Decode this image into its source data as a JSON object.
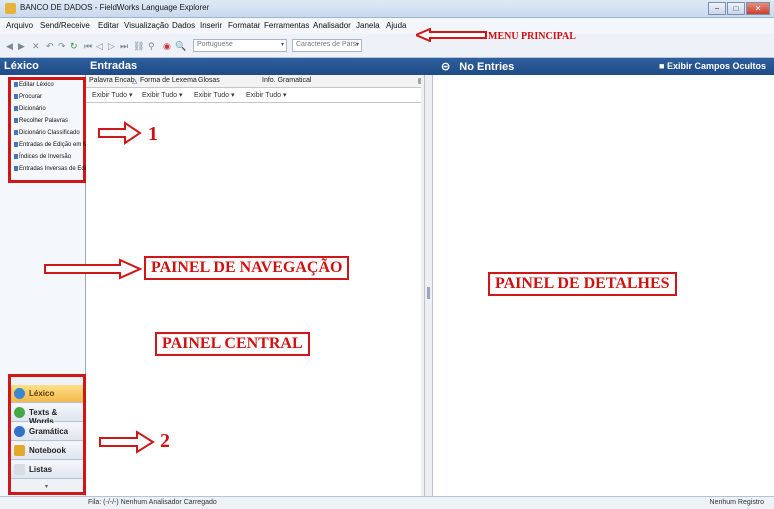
{
  "window": {
    "title": "BANCO DE DADOS - FieldWorks Language Explorer",
    "controls": [
      "−",
      "□",
      "✕"
    ]
  },
  "menu": {
    "items": [
      "Arquivo",
      "Send/Receive",
      "Editar",
      "Visualização",
      "Dados",
      "Inserir",
      "Formatar",
      "Ferramentas",
      "Analisador",
      "Janela",
      "Ajuda"
    ]
  },
  "toolbar": {
    "language": "Portuguese",
    "characters": "Caracteres de Parsi"
  },
  "nav": {
    "header": "Léxico",
    "items": [
      "Editar Léxico",
      "Procurar",
      "Dicionário",
      "Recolher Palavras",
      "Dicionário Classificado",
      "Entradas de Edição em M",
      "Índices de Inversão",
      "Entradas Inversas de Edi"
    ],
    "areas": [
      "Léxico",
      "Texts & Words",
      "Gramática",
      "Notebook",
      "Listas"
    ]
  },
  "center": {
    "header": "Entradas",
    "columns": [
      "Palavra Encab.",
      "Forma de Lexema",
      "Glosas",
      "Info. Gramatical"
    ],
    "filter_label": "Exibir Tudo"
  },
  "detail": {
    "header": "No Entries",
    "show_hidden": "Exibir Campos Ocultos"
  },
  "status": {
    "left": "Fila: (-/-/-) Nenhum Analisador Carregado",
    "right": "Nenhum Registro"
  },
  "annotations": {
    "menu_principal": "MENU PRINCIPAL",
    "one": "1",
    "two": "2",
    "painel_navegacao": "PAINEL DE NAVEGAÇÃO",
    "painel_central": "PAINEL CENTRAL",
    "painel_detalhes": "PAINEL DE DETALHES"
  },
  "colors": {
    "header_blue": "#1f4b85",
    "annotation_red": "#d01717",
    "active_area": "#f2b84a"
  }
}
